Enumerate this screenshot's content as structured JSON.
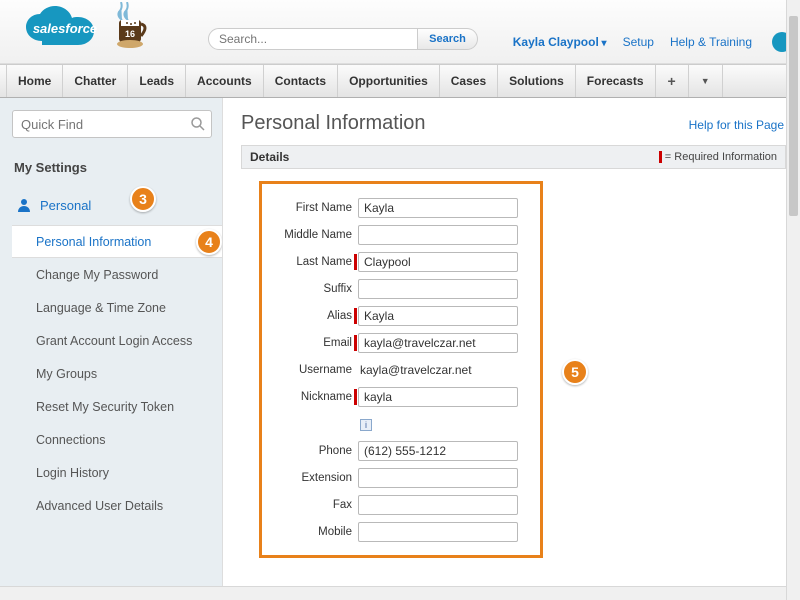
{
  "header": {
    "logo_text": "salesforce",
    "mug_number": "16",
    "search_placeholder": "Search...",
    "search_button": "Search",
    "user": "Kayla Claypool",
    "setup": "Setup",
    "help": "Help & Training"
  },
  "nav": [
    "Home",
    "Chatter",
    "Leads",
    "Accounts",
    "Contacts",
    "Opportunities",
    "Cases",
    "Solutions",
    "Forecasts"
  ],
  "sidebar": {
    "quickfind_placeholder": "Quick Find",
    "section_title": "My Settings",
    "personal_label": "Personal",
    "items": [
      "Personal Information",
      "Change My Password",
      "Language & Time Zone",
      "Grant Account Login Access",
      "My Groups",
      "Reset My Security Token",
      "Connections",
      "Login History",
      "Advanced User Details"
    ]
  },
  "badges": {
    "b3": "3",
    "b4": "4",
    "b5": "5"
  },
  "content": {
    "title": "Personal Information",
    "help_link": "Help for this Page",
    "details_label": "Details",
    "required_note": "= Required Information",
    "form": {
      "first_name": {
        "label": "First Name",
        "value": "Kayla"
      },
      "middle_name": {
        "label": "Middle Name",
        "value": ""
      },
      "last_name": {
        "label": "Last Name",
        "value": "Claypool"
      },
      "suffix": {
        "label": "Suffix",
        "value": ""
      },
      "alias": {
        "label": "Alias",
        "value": "Kayla"
      },
      "email": {
        "label": "Email",
        "value": "kayla@travelczar.net"
      },
      "username": {
        "label": "Username",
        "value": "kayla@travelczar.net"
      },
      "nickname": {
        "label": "Nickname",
        "value": "kayla"
      },
      "phone": {
        "label": "Phone",
        "value": "(612) 555-1212"
      },
      "extension": {
        "label": "Extension",
        "value": ""
      },
      "fax": {
        "label": "Fax",
        "value": ""
      },
      "mobile": {
        "label": "Mobile",
        "value": ""
      }
    }
  }
}
